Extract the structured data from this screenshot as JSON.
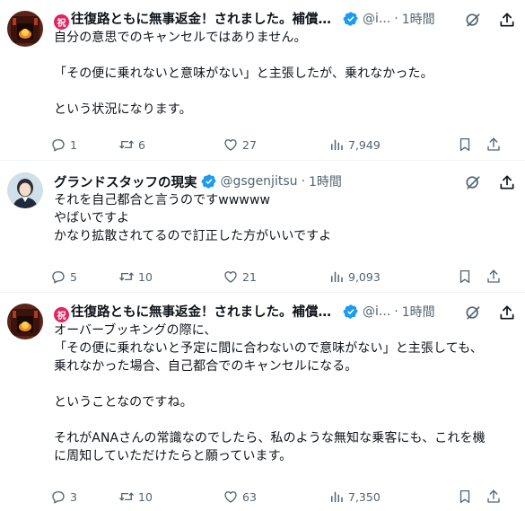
{
  "tweets": [
    {
      "badge": "祝",
      "name": "往復路ともに無事返金！されました。補償マイ...",
      "handle": "@i...",
      "dot": "·",
      "time": "1時間",
      "text": "自分の意思でのキャンセルではありません。\n\n「その便に乗れないと意味がない」と主張したが、乗れなかった。\n\nという状況になります。",
      "replies": "1",
      "retweets": "6",
      "likes": "27",
      "views": "7,949"
    },
    {
      "name": "グランドスタッフの現実",
      "handle": "@gsgenjitsu",
      "dot": "·",
      "time": "1時間",
      "text": "それを自己都合と言うのですwwwww\nやばいですよ\nかなり拡散されてるので訂正した方がいいですよ",
      "replies": "5",
      "retweets": "10",
      "likes": "21",
      "views": "9,093"
    },
    {
      "badge": "祝",
      "name": "往復路ともに無事返金！されました。補償マイ...",
      "handle": "@i...",
      "dot": "·",
      "time": "1時間",
      "text": "オーバーブッキングの際に、\n「その便に乗れないと予定に間に合わないので意味がない」と主張しても、\n乗れなかった場合、自己都合でのキャンセルになる。\n\nということなのですね。\n\nそれがANAさんの常識なのでしたら、私のような無知な乗客にも、これを機\nに周知していただけたらと願っています。",
      "replies": "3",
      "retweets": "10",
      "likes": "63",
      "views": "7,350"
    }
  ],
  "colors": {
    "verified": "#1d9bf0",
    "muted": "#536471",
    "badge": "#e0245e"
  },
  "icons": [
    "reply-icon",
    "retweet-icon",
    "like-icon",
    "views-icon",
    "bookmark-icon",
    "share-icon",
    "grok-icon",
    "more-icon",
    "verified-icon"
  ]
}
